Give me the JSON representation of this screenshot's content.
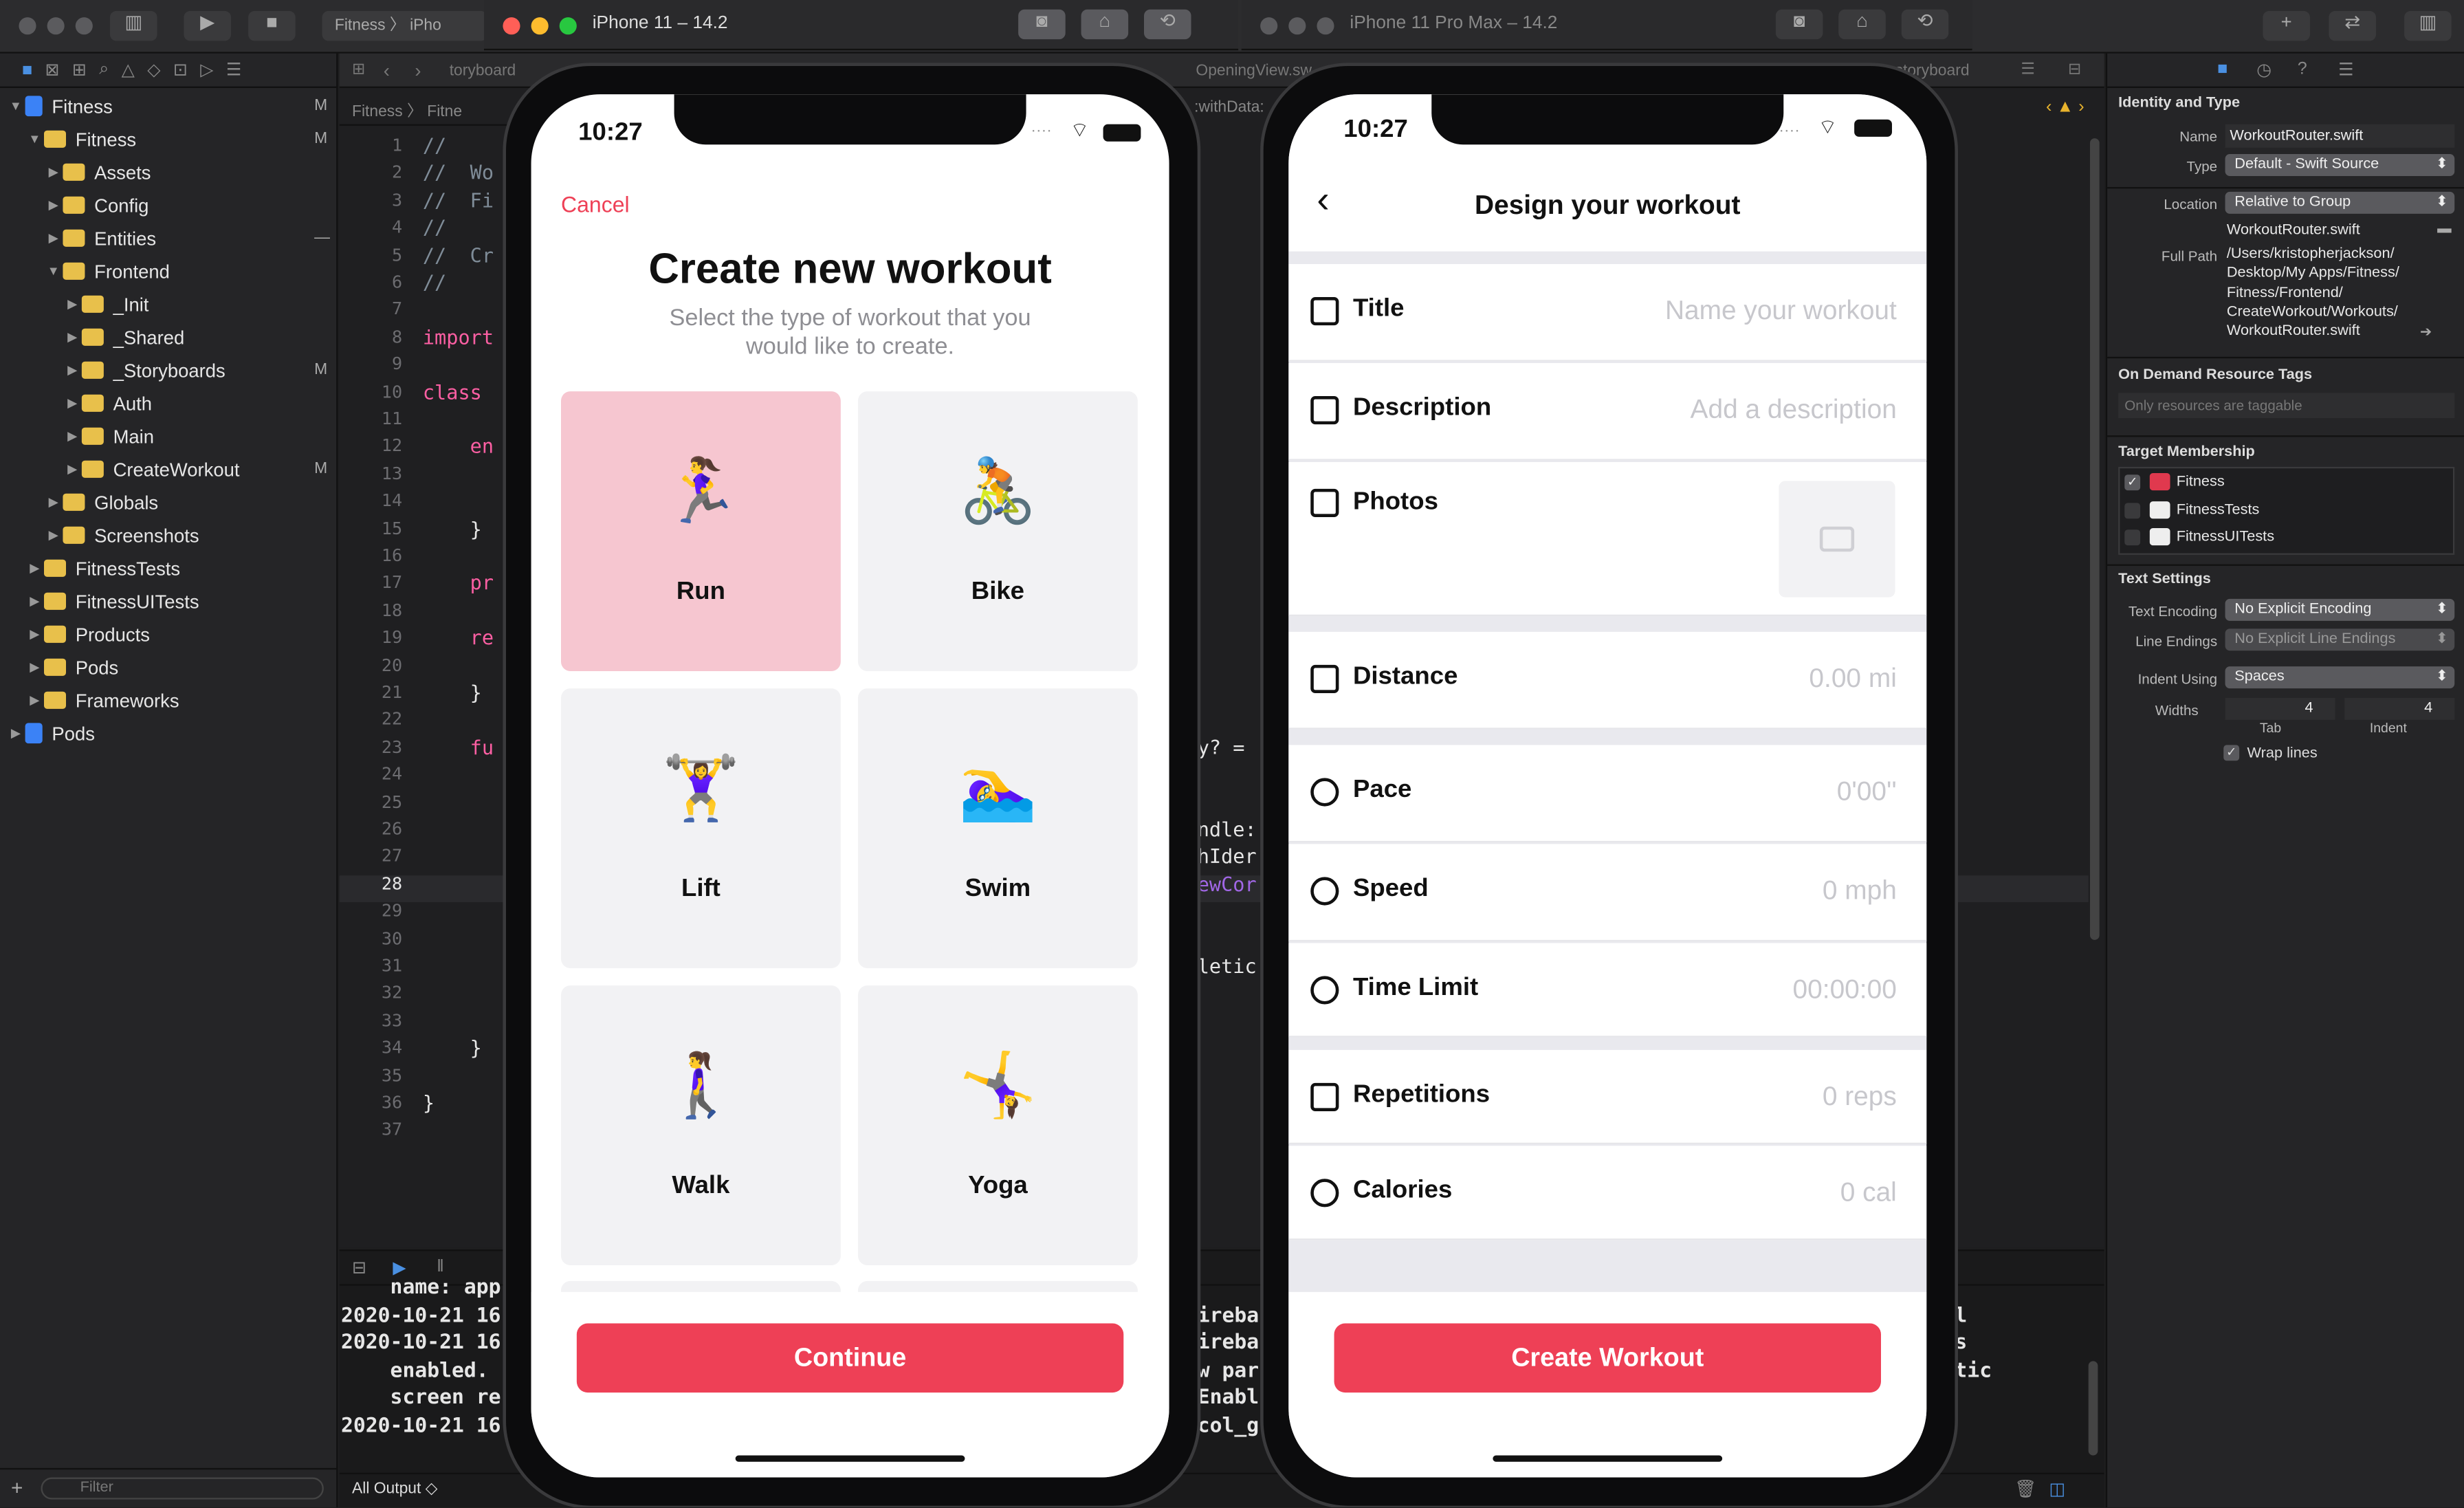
{
  "xcode": {
    "scheme": "Fitness",
    "device_short": "iPho",
    "jump_bar": [
      "Fitness",
      "Fitne"
    ],
    "storyboard_tab": "toryboard",
    "storyboard_tab_right": "storyboard",
    "opening_tab": "OpeningView.sw",
    "with_data": ":withData:",
    "console_filter": "All Output",
    "nav_filter": "Filter"
  },
  "navigator": {
    "items": [
      {
        "label": "Fitness",
        "depth": 0,
        "open": true,
        "blue": true,
        "mark": "M"
      },
      {
        "label": "Fitness",
        "depth": 1,
        "open": true,
        "mark": "M"
      },
      {
        "label": "Assets",
        "depth": 2,
        "open": false
      },
      {
        "label": "Config",
        "depth": 2,
        "open": false
      },
      {
        "label": "Entities",
        "depth": 2,
        "open": false,
        "mark": "—"
      },
      {
        "label": "Frontend",
        "depth": 2,
        "open": true
      },
      {
        "label": "_Init",
        "depth": 3,
        "open": false
      },
      {
        "label": "_Shared",
        "depth": 3,
        "open": false
      },
      {
        "label": "_Storyboards",
        "depth": 3,
        "open": false,
        "mark": "M"
      },
      {
        "label": "Auth",
        "depth": 3,
        "open": false
      },
      {
        "label": "Main",
        "depth": 3,
        "open": false
      },
      {
        "label": "CreateWorkout",
        "depth": 3,
        "open": false,
        "mark": "M"
      },
      {
        "label": "Globals",
        "depth": 2,
        "open": false
      },
      {
        "label": "Screenshots",
        "depth": 2,
        "open": false
      },
      {
        "label": "FitnessTests",
        "depth": 1,
        "open": false
      },
      {
        "label": "FitnessUITests",
        "depth": 1,
        "open": false
      },
      {
        "label": "Products",
        "depth": 1,
        "open": false
      },
      {
        "label": "Pods",
        "depth": 1,
        "open": false
      },
      {
        "label": "Frameworks",
        "depth": 1,
        "open": false
      },
      {
        "label": "Pods",
        "depth": 0,
        "open": false,
        "blue": true
      }
    ]
  },
  "editor": {
    "line_numbers": [
      "1",
      "2",
      "3",
      "4",
      "5",
      "6",
      "7",
      "8",
      "9",
      "10",
      "11",
      "12",
      "13",
      "14",
      "15",
      "16",
      "17",
      "18",
      "19",
      "20",
      "21",
      "22",
      "23",
      "24",
      "25",
      "26",
      "27",
      "28",
      "29",
      "30",
      "31",
      "32",
      "33",
      "34",
      "35",
      "36",
      "37"
    ],
    "current_line": "28",
    "code": [
      {
        "text": "//",
        "line": 1,
        "color": "#7f8c98"
      },
      {
        "text": "//  Wo",
        "line": 2,
        "color": "#7f8c98"
      },
      {
        "text": "//  Fi",
        "line": 3,
        "color": "#7f8c98"
      },
      {
        "text": "//",
        "line": 4,
        "color": "#7f8c98"
      },
      {
        "text": "//  Cr",
        "line": 5,
        "color": "#7f8c98"
      },
      {
        "text": "//",
        "line": 6,
        "color": "#7f8c98"
      },
      {
        "text": "import",
        "line": 8,
        "color": "#fc5fa3"
      },
      {
        "text": "class",
        "line": 10,
        "color": "#fc5fa3"
      },
      {
        "text": "    en",
        "line": 12,
        "color": "#fc5fa3"
      },
      {
        "text": "    }",
        "line": 15,
        "color": "#e6e6e6"
      },
      {
        "text": "    pr",
        "line": 17,
        "color": "#fc5fa3"
      },
      {
        "text": "    re",
        "line": 19,
        "color": "#fc5fa3"
      },
      {
        "text": "    }",
        "line": 21,
        "color": "#e6e6e6"
      },
      {
        "text": "    fu",
        "line": 23,
        "color": "#fc5fa3"
      },
      {
        "text": "    }",
        "line": 34,
        "color": "#e6e6e6"
      },
      {
        "text": "}",
        "line": 36,
        "color": "#e6e6e6"
      }
    ],
    "code_right": [
      {
        "text": "y? =",
        "line": 23,
        "color": "#e6e6e6"
      },
      {
        "text": "ndle:",
        "line": 26,
        "color": "#e6e6e6"
      },
      {
        "text": "hIder",
        "line": 27,
        "color": "#e6e6e6"
      },
      {
        "text": "ewCor",
        "line": 28,
        "color": "#a167e6"
      },
      {
        "text": "letic",
        "line": 31,
        "color": "#e6e6e6"
      }
    ]
  },
  "console": {
    "left": [
      "    name: app",
      "2020-10-21 16",
      "2020-10-21 16",
      "    enabled.",
      "    screen re",
      "2020-10-21 16"
    ],
    "mid": [
      "",
      "ireba",
      "ireba",
      "w par",
      "Enabl",
      "col_g"
    ],
    "right": [
      "",
      "l",
      "s",
      "tic",
      "",
      ""
    ]
  },
  "inspector": {
    "section_identity": "Identity and Type",
    "name_label": "Name",
    "name_value": "WorkoutRouter.swift",
    "type_label": "Type",
    "type_value": "Default - Swift Source",
    "location_label": "Location",
    "location_value": "Relative to Group",
    "location_file": "WorkoutRouter.swift",
    "fullpath_label": "Full Path",
    "fullpath_lines": [
      "/Users/kristopherjackson/",
      "Desktop/My Apps/Fitness/",
      "Fitness/Frontend/",
      "CreateWorkout/Workouts/",
      "WorkoutRouter.swift"
    ],
    "section_tags": "On Demand Resource Tags",
    "tags_placeholder": "Only resources are taggable",
    "section_target": "Target Membership",
    "targets": [
      {
        "label": "Fitness",
        "checked": true
      },
      {
        "label": "FitnessTests",
        "checked": false
      },
      {
        "label": "FitnessUITests",
        "checked": false
      }
    ],
    "section_text": "Text Settings",
    "encoding_label": "Text Encoding",
    "encoding_value": "No Explicit Encoding",
    "endings_label": "Line Endings",
    "endings_value": "No Explicit Line Endings",
    "indent_label": "Indent Using",
    "indent_value": "Spaces",
    "widths_label": "Widths",
    "tab_value": "4",
    "indent_width_value": "4",
    "tab_caption": "Tab",
    "indent_caption": "Indent",
    "wrap_label": "Wrap lines"
  },
  "sim1": {
    "title": "iPhone 11 – 14.2",
    "time": "10:27",
    "cancel": "Cancel",
    "heading": "Create new workout",
    "subheading": "Select the type of workout that you would like to create.",
    "cards": [
      {
        "label": "Run",
        "emoji": "🏃‍♀️",
        "selected": true
      },
      {
        "label": "Bike",
        "emoji": "🚴",
        "selected": false
      },
      {
        "label": "Lift",
        "emoji": "🏋️‍♀️",
        "selected": false
      },
      {
        "label": "Swim",
        "emoji": "🏊‍♀️",
        "selected": false
      },
      {
        "label": "Walk",
        "emoji": "🚶‍♀️",
        "selected": false
      },
      {
        "label": "Yoga",
        "emoji": "🤸‍♀️",
        "selected": false
      }
    ],
    "continue": "Continue",
    "accent": "#ee4056",
    "selected_bg": "#f6c6d0"
  },
  "sim2": {
    "title": "iPhone 11 Pro Max – 14.2",
    "time": "10:27",
    "nav_title": "Design your workout",
    "fields": [
      {
        "label": "Title",
        "placeholder": "Name your workout",
        "icon": "title-icon"
      },
      {
        "label": "Description",
        "placeholder": "Add a description",
        "icon": "description-icon"
      },
      {
        "label": "Photos",
        "placeholder": "",
        "icon": "photos-icon"
      },
      {
        "label": "Distance",
        "placeholder": "0.00 mi",
        "icon": "ruler-icon"
      },
      {
        "label": "Pace",
        "placeholder": "0'00''",
        "icon": "clock-icon"
      },
      {
        "label": "Speed",
        "placeholder": "0 mph",
        "icon": "speedometer-icon"
      },
      {
        "label": "Time Limit",
        "placeholder": "00:00:00",
        "icon": "stopwatch-icon"
      },
      {
        "label": "Repetitions",
        "placeholder": "0 reps",
        "icon": "repeat-icon"
      },
      {
        "label": "Calories",
        "placeholder": "0 cal",
        "icon": "flame-icon"
      }
    ],
    "create": "Create Workout"
  }
}
